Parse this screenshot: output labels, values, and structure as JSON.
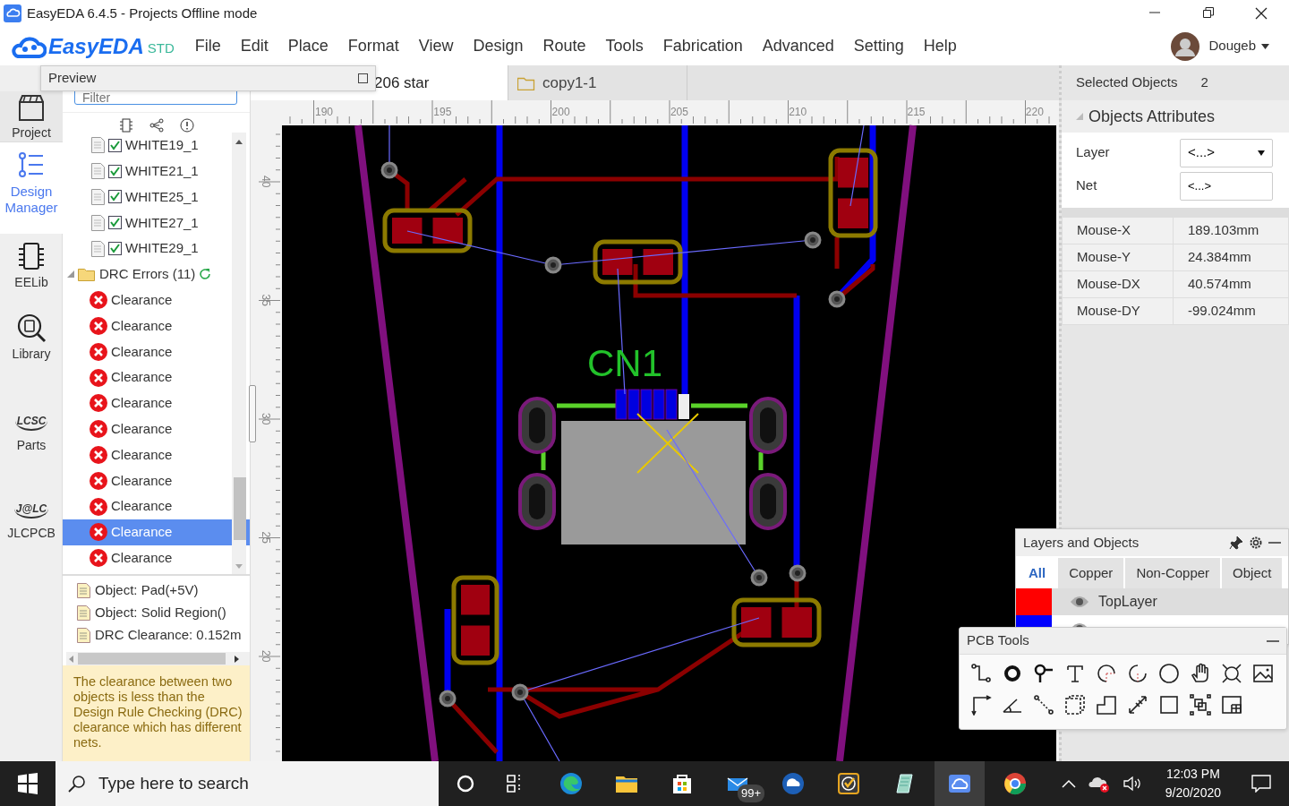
{
  "window": {
    "title": "EasyEDA 6.4.5 - Projects Offline mode"
  },
  "app_logo": {
    "name": "EasyEDA",
    "edition": "STD"
  },
  "menu": [
    "File",
    "Edit",
    "Place",
    "Format",
    "View",
    "Design",
    "Route",
    "Tools",
    "Fabrication",
    "Advanced",
    "Setting",
    "Help"
  ],
  "user": {
    "name": "Dougeb"
  },
  "left_nav": [
    {
      "kind": "project",
      "label": "Project",
      "selected": false
    },
    {
      "kind": "design",
      "label": "Design Manager",
      "selected": true
    },
    {
      "kind": "eelib",
      "label": "EELib",
      "selected": false
    },
    {
      "kind": "library",
      "label": "Library",
      "selected": false
    },
    {
      "kind": "lcsc",
      "logo_text": "LCSC",
      "label": "Parts",
      "selected": false
    },
    {
      "kind": "jlc",
      "logo_text": "J@LC",
      "label": "JLCPCB",
      "selected": false
    }
  ],
  "preview_panel": {
    "title": "Preview"
  },
  "filter": {
    "placeholder": "Filter"
  },
  "tree": [
    {
      "kind": "layer",
      "label": "WHITE19_1",
      "checked": true
    },
    {
      "kind": "layer",
      "label": "WHITE21_1",
      "checked": true
    },
    {
      "kind": "layer",
      "label": "WHITE25_1",
      "checked": true
    },
    {
      "kind": "layer",
      "label": "WHITE27_1",
      "checked": true
    },
    {
      "kind": "layer",
      "label": "WHITE29_1",
      "checked": true
    },
    {
      "kind": "folder",
      "label": "DRC Errors (11)",
      "expanded": true,
      "children": [
        {
          "label": "Clearance",
          "selected": false
        },
        {
          "label": "Clearance",
          "selected": false
        },
        {
          "label": "Clearance",
          "selected": false
        },
        {
          "label": "Clearance",
          "selected": false
        },
        {
          "label": "Clearance",
          "selected": false
        },
        {
          "label": "Clearance",
          "selected": false
        },
        {
          "label": "Clearance",
          "selected": false
        },
        {
          "label": "Clearance",
          "selected": false
        },
        {
          "label": "Clearance",
          "selected": false
        },
        {
          "label": "Clearance",
          "selected": true
        },
        {
          "label": "Clearance",
          "selected": false
        }
      ]
    }
  ],
  "details": [
    "Object: Pad(+5V)",
    "Object: Solid Region()",
    "DRC Clearance: 0.152m"
  ],
  "help_text": "The clearance between two objects is less than the Design Rule Checking (DRC) clearance which has different nets.",
  "doc_tabs": [
    {
      "label": "206 star",
      "selected": true
    },
    {
      "label": "copy1-1",
      "selected": false
    }
  ],
  "ruler": {
    "x_labels": [
      "190",
      "195",
      "200",
      "205",
      "210",
      "215",
      "220"
    ],
    "y_labels": [
      "40",
      "35",
      "30",
      "25",
      "20"
    ]
  },
  "canvas": {
    "silkscreen_label": "CN1"
  },
  "properties": {
    "selected_label": "Selected Objects",
    "selected_count": "2",
    "section_title": "Objects Attributes",
    "expanded": true,
    "fields": [
      {
        "kind": "select",
        "label": "Layer",
        "value": "<...>"
      },
      {
        "kind": "input",
        "label": "Net",
        "value": "<...>"
      }
    ],
    "readouts": [
      {
        "label": "Mouse-X",
        "value": "189.103mm"
      },
      {
        "label": "Mouse-Y",
        "value": "24.384mm"
      },
      {
        "label": "Mouse-DX",
        "value": "40.574mm"
      },
      {
        "label": "Mouse-DY",
        "value": "-99.024mm"
      }
    ]
  },
  "layers_panel": {
    "title": "Layers and Objects",
    "tabs": [
      {
        "label": "All",
        "selected": true
      },
      {
        "label": "Copper",
        "selected": false
      },
      {
        "label": "Non-Copper",
        "selected": false
      },
      {
        "label": "Object",
        "selected": false
      }
    ],
    "layers": [
      {
        "name": "TopLayer",
        "color": "#ff0000"
      },
      {
        "color": "#0000ff"
      }
    ]
  },
  "pcb_tools": {
    "title": "PCB Tools"
  },
  "taskbar": {
    "search_placeholder": "Type here to search",
    "mail_badge": "99+",
    "time": "12:03 PM",
    "date": "9/20/2020"
  }
}
